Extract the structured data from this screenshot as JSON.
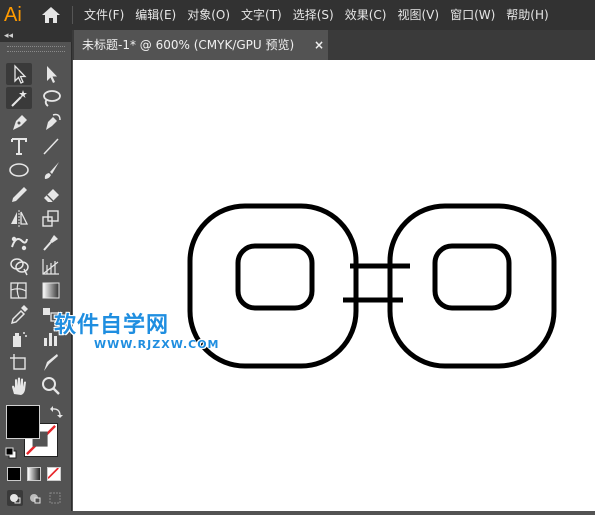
{
  "app": {
    "logo": "Ai",
    "home_icon": "home-icon"
  },
  "menu": {
    "items": [
      {
        "label": "文件(F)"
      },
      {
        "label": "编辑(E)"
      },
      {
        "label": "对象(O)"
      },
      {
        "label": "文字(T)"
      },
      {
        "label": "选择(S)"
      },
      {
        "label": "效果(C)"
      },
      {
        "label": "视图(V)"
      },
      {
        "label": "窗口(W)"
      },
      {
        "label": "帮助(H)"
      }
    ]
  },
  "panel": {
    "collapse_label": "◂◂"
  },
  "document": {
    "tab_label": "未标题-1* @ 600% (CMYK/GPU 预览)",
    "close_label": "×"
  },
  "tools": [
    "selection-tool-icon",
    "direct-selection-tool-icon",
    "magic-wand-tool-icon",
    "lasso-tool-icon",
    "pen-tool-icon",
    "curvature-tool-icon",
    "type-tool-icon",
    "line-segment-tool-icon",
    "ellipse-tool-icon",
    "paintbrush-tool-icon",
    "pencil-tool-icon",
    "eraser-tool-icon",
    "reflect-tool-icon",
    "scale-tool-icon",
    "puppet-warp-tool-icon",
    "free-transform-tool-icon",
    "shape-builder-tool-icon",
    "perspective-grid-tool-icon",
    "mesh-tool-icon",
    "gradient-tool-icon",
    "eyedropper-tool-icon",
    "blend-tool-icon",
    "symbol-sprayer-tool-icon",
    "column-graph-tool-icon",
    "artboard-tool-icon",
    "slice-tool-icon",
    "hand-tool-icon",
    "zoom-tool-icon"
  ],
  "colors": {
    "fill": "#000000",
    "stroke": "none",
    "menubar": "#323232",
    "panel": "#535353",
    "accent": "#ff9a00"
  },
  "watermark": {
    "title": "软件自学网",
    "url": "WWW.RJZXW.COM",
    "color": "#1f8ee0"
  }
}
